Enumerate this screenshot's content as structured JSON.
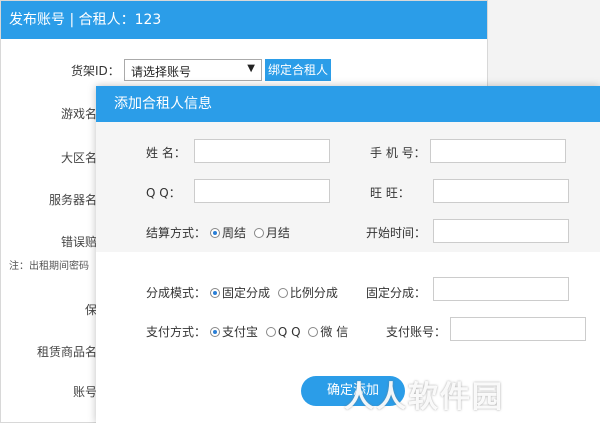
{
  "background_window": {
    "title": "发布账号 | 合租人：123",
    "shelf_label": "货架ID：",
    "shelf_select_value": "请选择账号",
    "bind_button": "绑定合租人",
    "labels": [
      "游戏名",
      "大区名",
      "服务器名",
      "错误赔",
      "保",
      "租赁商品名",
      "账号"
    ],
    "note": "注：出租期间密码"
  },
  "modal": {
    "title": "添加合租人信息",
    "name_label": "姓  名：",
    "phone_label": "手 机 号：",
    "qq_label": "Q  Q：",
    "wangwang_label": "旺    旺：",
    "settle_label": "结算方式：",
    "settle_options": [
      "周结",
      "月结"
    ],
    "start_time_label": "开始时间：",
    "split_mode_label": "分成模式：",
    "split_options": [
      "固定分成",
      "比例分成"
    ],
    "fixed_split_label": "固定分成：",
    "pay_method_label": "支付方式：",
    "pay_options": [
      "支付宝",
      "Q Q",
      "微 信"
    ],
    "pay_account_label": "支付账号：",
    "submit_button": "确定添加"
  },
  "watermark": "人人软件园",
  "colors": {
    "accent": "#2b9de8"
  }
}
